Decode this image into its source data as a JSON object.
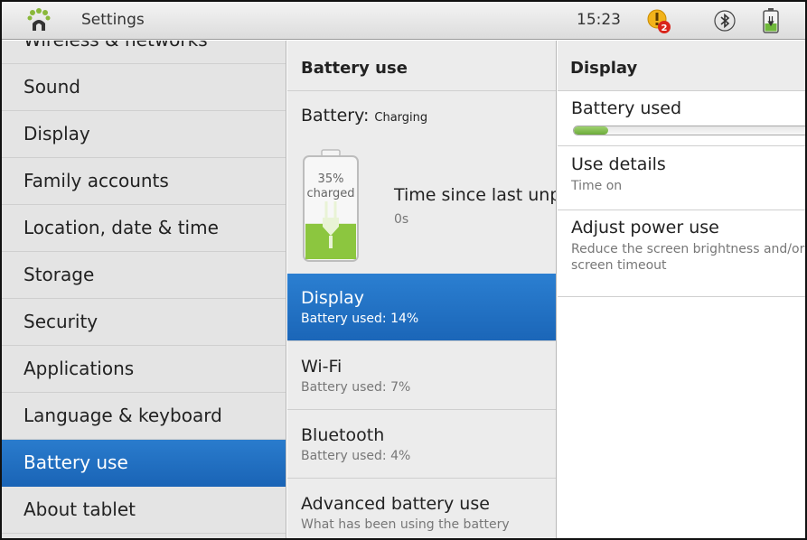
{
  "topbar": {
    "title": "Settings",
    "time": "15:23",
    "notification_count": "2"
  },
  "sidebar": {
    "items": [
      {
        "label": "Wireless & networks"
      },
      {
        "label": "Sound"
      },
      {
        "label": "Display"
      },
      {
        "label": "Family accounts"
      },
      {
        "label": "Location, date & time"
      },
      {
        "label": "Storage"
      },
      {
        "label": "Security"
      },
      {
        "label": "Applications"
      },
      {
        "label": "Language & keyboard"
      },
      {
        "label": "Battery use",
        "selected": true
      },
      {
        "label": "About tablet"
      }
    ]
  },
  "battery_use": {
    "header": "Battery use",
    "status_label": "Battery:",
    "status_value": "Charging",
    "charge_percent": "35%",
    "charge_text": "charged",
    "charge_level": 0.35,
    "since_label": "Time since last unplugged",
    "since_value": "0s",
    "items": [
      {
        "title": "Display",
        "subtitle": "Battery used:  14%",
        "selected": true
      },
      {
        "title": "Wi-Fi",
        "subtitle": "Battery used:  7%"
      },
      {
        "title": "Bluetooth",
        "subtitle": "Battery used:  4%"
      },
      {
        "title": "Advanced battery use",
        "subtitle": "What has been using the battery"
      }
    ]
  },
  "detail": {
    "header": "Display",
    "battery_used_label": "Battery used",
    "battery_used_fraction": 0.14,
    "items": [
      {
        "title": "Use details",
        "subtitle": "Time on"
      },
      {
        "title": "Adjust power use",
        "subtitle": "Reduce the screen brightness and/or screen timeout"
      }
    ]
  },
  "colors": {
    "selection": "#1f6fc2",
    "battery_green": "#8cc63f"
  }
}
